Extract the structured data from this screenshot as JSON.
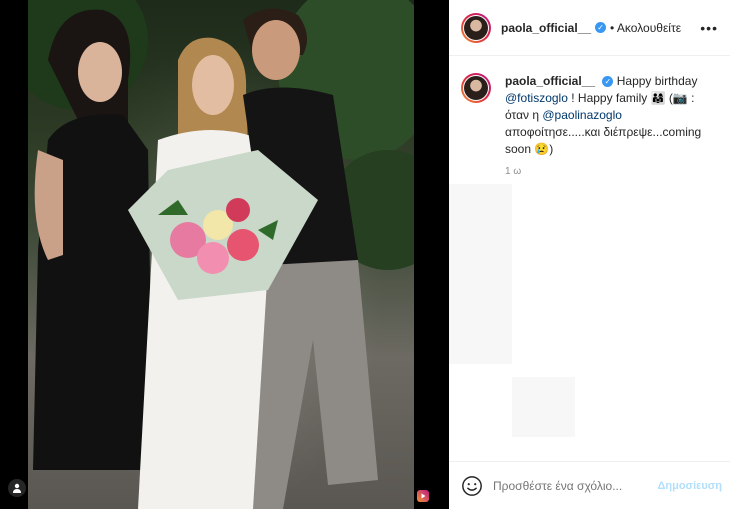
{
  "post": {
    "username": "paola_official__",
    "follow_status": "• Ακολουθείτε",
    "more_icon": "more-horizontal-icon",
    "verified_icon": "verified-badge-icon"
  },
  "caption": {
    "username": "paola_official__",
    "text_1": "Happy birthday",
    "mention_1": "@fotiszoglo",
    "text_2": "! Happy family 👨‍👩‍👧 (📷 :",
    "text_3": "όταν η",
    "mention_2": "@paolinazoglo",
    "text_4": "αποφοίτησε.....και διέπρεψε...coming soon 😢)",
    "time": "1 ω"
  },
  "comment_box": {
    "placeholder": "Προσθέστε ένα σχόλιο...",
    "post_label": "Δημοσίευση",
    "emoji_icon": "smiley-icon"
  },
  "colors": {
    "link": "#00376b",
    "verified": "#3897f0",
    "post_disabled": "#b2dffc"
  }
}
